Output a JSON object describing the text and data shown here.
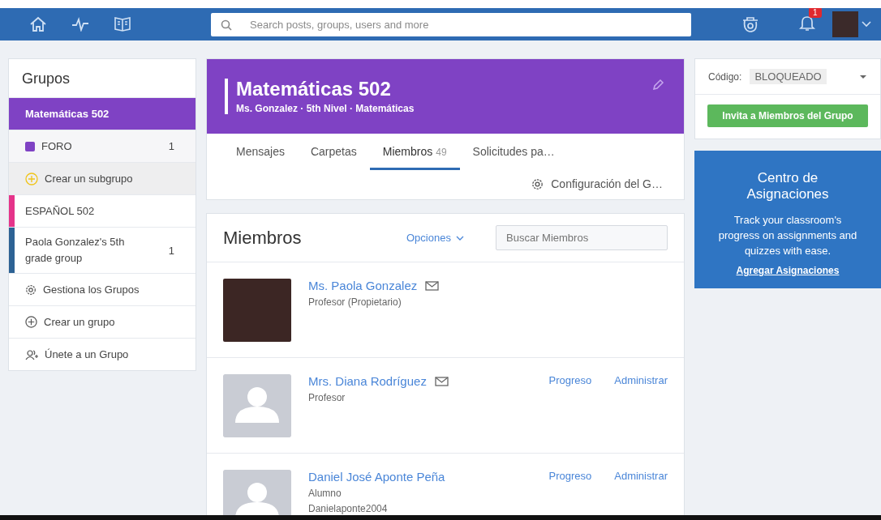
{
  "topbar": {
    "search": {
      "placeholder": "Search posts, groups, users and more"
    },
    "notifications_badge": "1"
  },
  "sidebar": {
    "title": "Grupos",
    "items": [
      {
        "kind": "group",
        "label": "Matemáticas 502",
        "selected": true
      },
      {
        "kind": "subgroup",
        "label": "FORO",
        "count": "1",
        "color": "#7f42c4"
      },
      {
        "kind": "create-subgroup",
        "label": "Crear un subgrupo"
      },
      {
        "kind": "group",
        "label": "ESPAÑOL 502",
        "selected": false,
        "color": "#e5348a"
      },
      {
        "kind": "group",
        "label": "Paola Gonzalez's 5th grade group",
        "count": "1",
        "selected": false,
        "color": "#2d6294"
      },
      {
        "kind": "manage",
        "label": "Gestiona los Grupos"
      },
      {
        "kind": "create",
        "label": "Crear un grupo"
      },
      {
        "kind": "join",
        "label": "Únete a un Grupo"
      }
    ]
  },
  "group_header": {
    "title": "Matemáticas 502",
    "subtitle": "Ms. Gonzalez · 5th Nivel · Matemáticas"
  },
  "tabs": [
    {
      "label": "Mensajes",
      "selected": false
    },
    {
      "label": "Carpetas",
      "selected": false
    },
    {
      "label": "Miembros",
      "count": "49",
      "selected": true
    },
    {
      "label": "Solicitudes pa…",
      "selected": false
    }
  ],
  "settings_link": "Configuración del G…",
  "members_panel": {
    "title": "Miembros",
    "options": "Opciones",
    "search": {
      "placeholder": "Buscar Miembros"
    },
    "members": [
      {
        "photo": true,
        "name": "Ms. Paola Gonzalez",
        "email_icon": true,
        "role": "Profesor (Propietario)"
      },
      {
        "photo": false,
        "name": "Mrs. Diana Rodríguez",
        "email_icon": true,
        "role": "Profesor",
        "actions": [
          "Progreso",
          "Administrar"
        ]
      },
      {
        "photo": false,
        "name": "Daniel José Aponte Peña",
        "email_icon": false,
        "role": "Alumno",
        "username": "Danielaponte2004",
        "actions": [
          "Progreso",
          "Administrar"
        ]
      }
    ]
  },
  "code_box": {
    "label": "Código:",
    "value": "BLOQUEADO",
    "button": "Invita a Miembros del Grupo"
  },
  "promo": {
    "title": "Centro de Asignaciones",
    "text": "Track your classroom's progress on assignments and quizzes with ease.",
    "link": "Agregar Asignaciones"
  }
}
